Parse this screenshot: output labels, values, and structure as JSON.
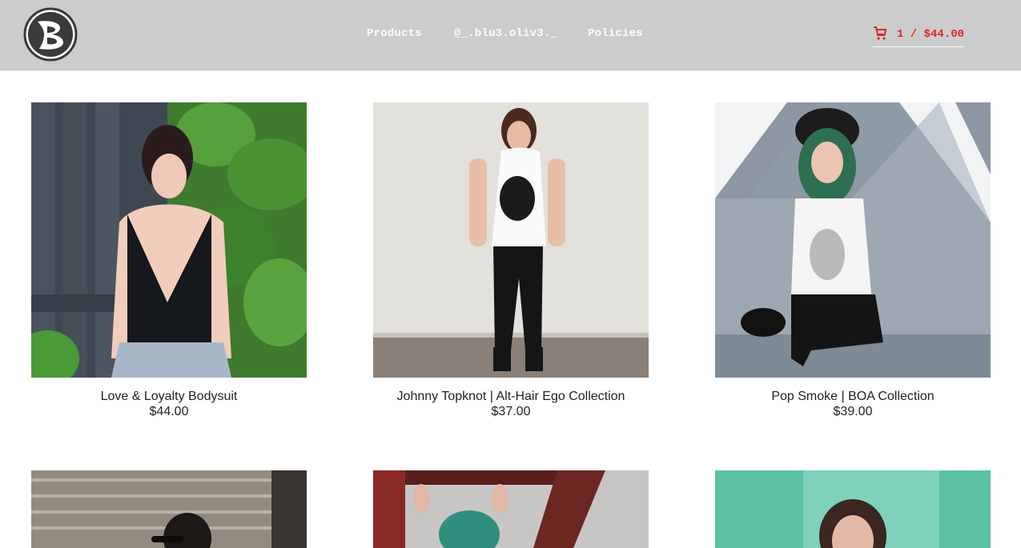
{
  "header": {
    "nav": [
      "Products",
      "@_.blu3.oliv3._",
      "Policies"
    ],
    "cart": {
      "count": "1",
      "total": "$44.00",
      "text": "1 / $44.00"
    },
    "colors": {
      "bar": "#cccccc",
      "nav_text": "#ffffff",
      "cart": "#e0242e"
    }
  },
  "products": [
    {
      "name": "Love & Loyalty Bodysuit",
      "price": "$44.00"
    },
    {
      "name": "Johnny Topknot | Alt-Hair Ego Collection",
      "price": "$37.00"
    },
    {
      "name": "Pop Smoke | BOA Collection",
      "price": "$39.00"
    },
    {
      "name": "",
      "price": ""
    },
    {
      "name": "",
      "price": ""
    },
    {
      "name": "",
      "price": ""
    }
  ],
  "icons": {
    "logo": "b3-logo-icon",
    "cart": "cart-icon"
  }
}
